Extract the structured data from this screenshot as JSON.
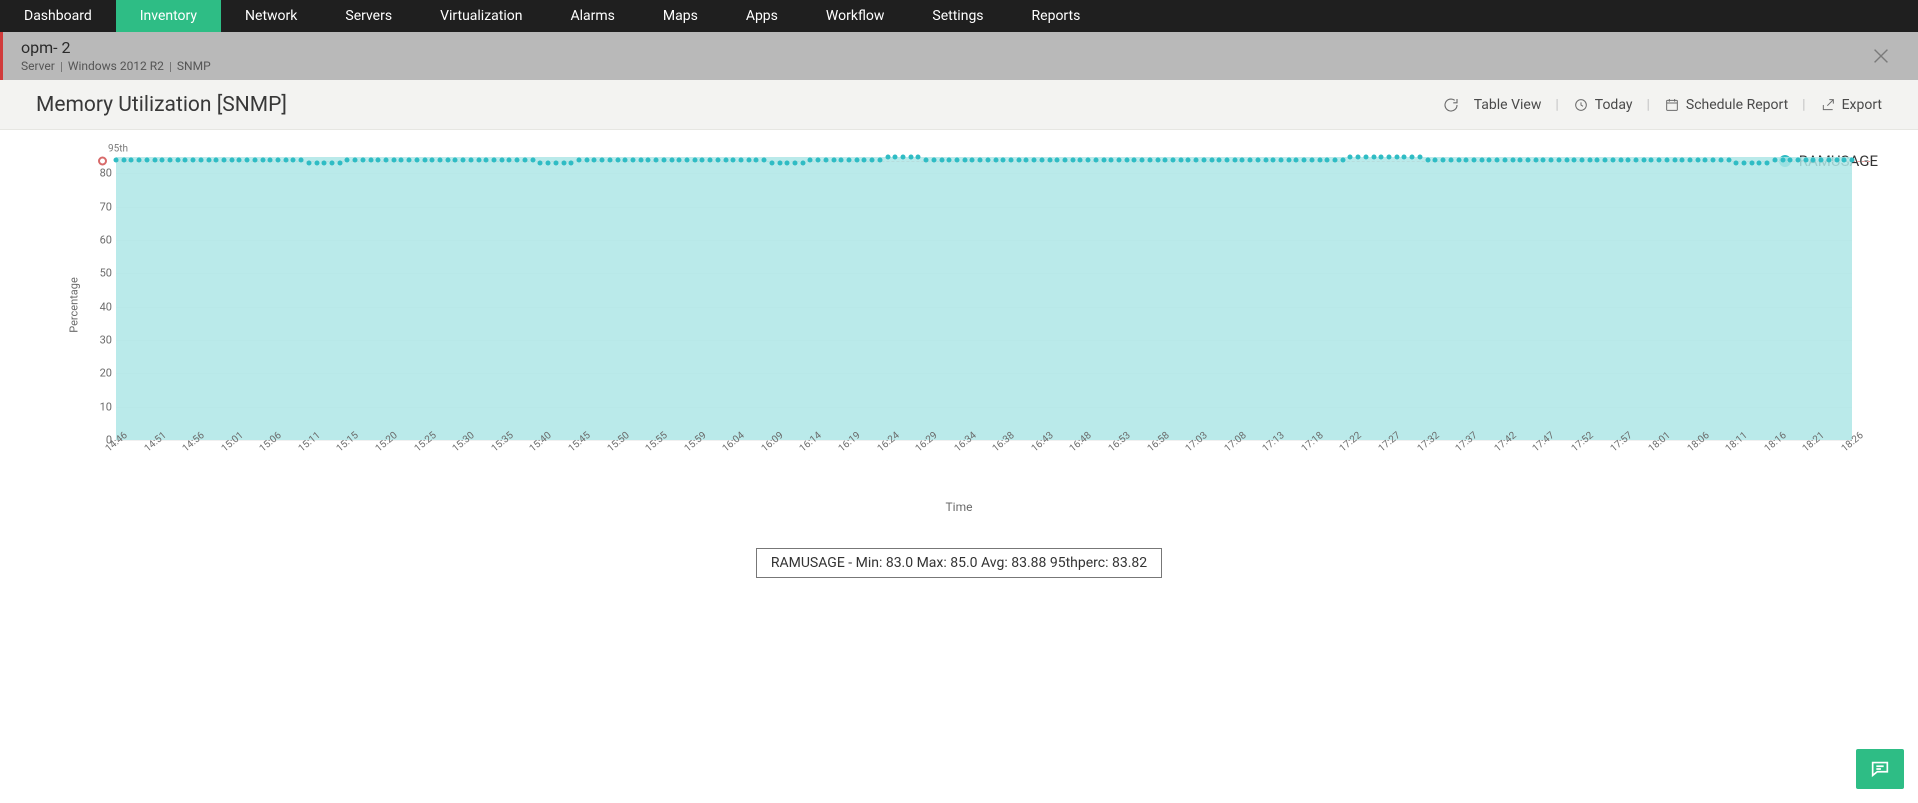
{
  "nav": {
    "tabs": [
      "Dashboard",
      "Inventory",
      "Network",
      "Servers",
      "Virtualization",
      "Alarms",
      "Maps",
      "Apps",
      "Workflow",
      "Settings",
      "Reports"
    ],
    "active": "Inventory"
  },
  "subheader": {
    "host": "opm-           2",
    "meta": [
      "Server",
      "Windows 2012 R2",
      "SNMP"
    ]
  },
  "title": "Memory Utilization [SNMP]",
  "actions": {
    "table_view": "Table View",
    "today": "Today",
    "schedule": "Schedule Report",
    "export": "Export"
  },
  "legend": {
    "series": "RAMUSAGE"
  },
  "stats_box": "RAMUSAGE - Min: 83.0 Max: 85.0 Avg: 83.88 95thperc: 83.82",
  "chart_data": {
    "type": "area",
    "title": "Memory Utilization [SNMP]",
    "xlabel": "Time",
    "ylabel": "Percentage",
    "ylim": [
      0,
      90
    ],
    "yticks": [
      0,
      10,
      20,
      30,
      40,
      50,
      60,
      70,
      80
    ],
    "p95_label": "95th",
    "p95_value": 83.82,
    "categories": [
      "14:46",
      "14:51",
      "14:56",
      "15:01",
      "15:06",
      "15:11",
      "15:15",
      "15:20",
      "15:25",
      "15:30",
      "15:35",
      "15:40",
      "15:45",
      "15:50",
      "15:55",
      "15:59",
      "16:04",
      "16:09",
      "16:14",
      "16:19",
      "16:24",
      "16:29",
      "16:34",
      "16:38",
      "16:43",
      "16:48",
      "16:53",
      "16:58",
      "17:03",
      "17:08",
      "17:13",
      "17:18",
      "17:22",
      "17:27",
      "17:32",
      "17:37",
      "17:42",
      "17:47",
      "17:52",
      "17:57",
      "18:01",
      "18:06",
      "18:11",
      "18:16",
      "18:21",
      "18:26"
    ],
    "series": [
      {
        "name": "RAMUSAGE",
        "values": [
          84,
          84,
          84,
          84,
          84,
          83,
          84,
          84,
          84,
          84,
          84,
          83,
          84,
          84,
          84,
          84,
          84,
          83,
          84,
          84,
          85,
          84,
          84,
          84,
          84,
          84,
          84,
          84,
          84,
          84,
          84,
          84,
          85,
          85,
          84,
          84,
          84,
          84,
          84,
          84,
          84,
          84,
          83,
          84,
          84,
          84
        ]
      }
    ],
    "stats": {
      "min": 83.0,
      "max": 85.0,
      "avg": 83.88,
      "p95": 83.82
    }
  }
}
